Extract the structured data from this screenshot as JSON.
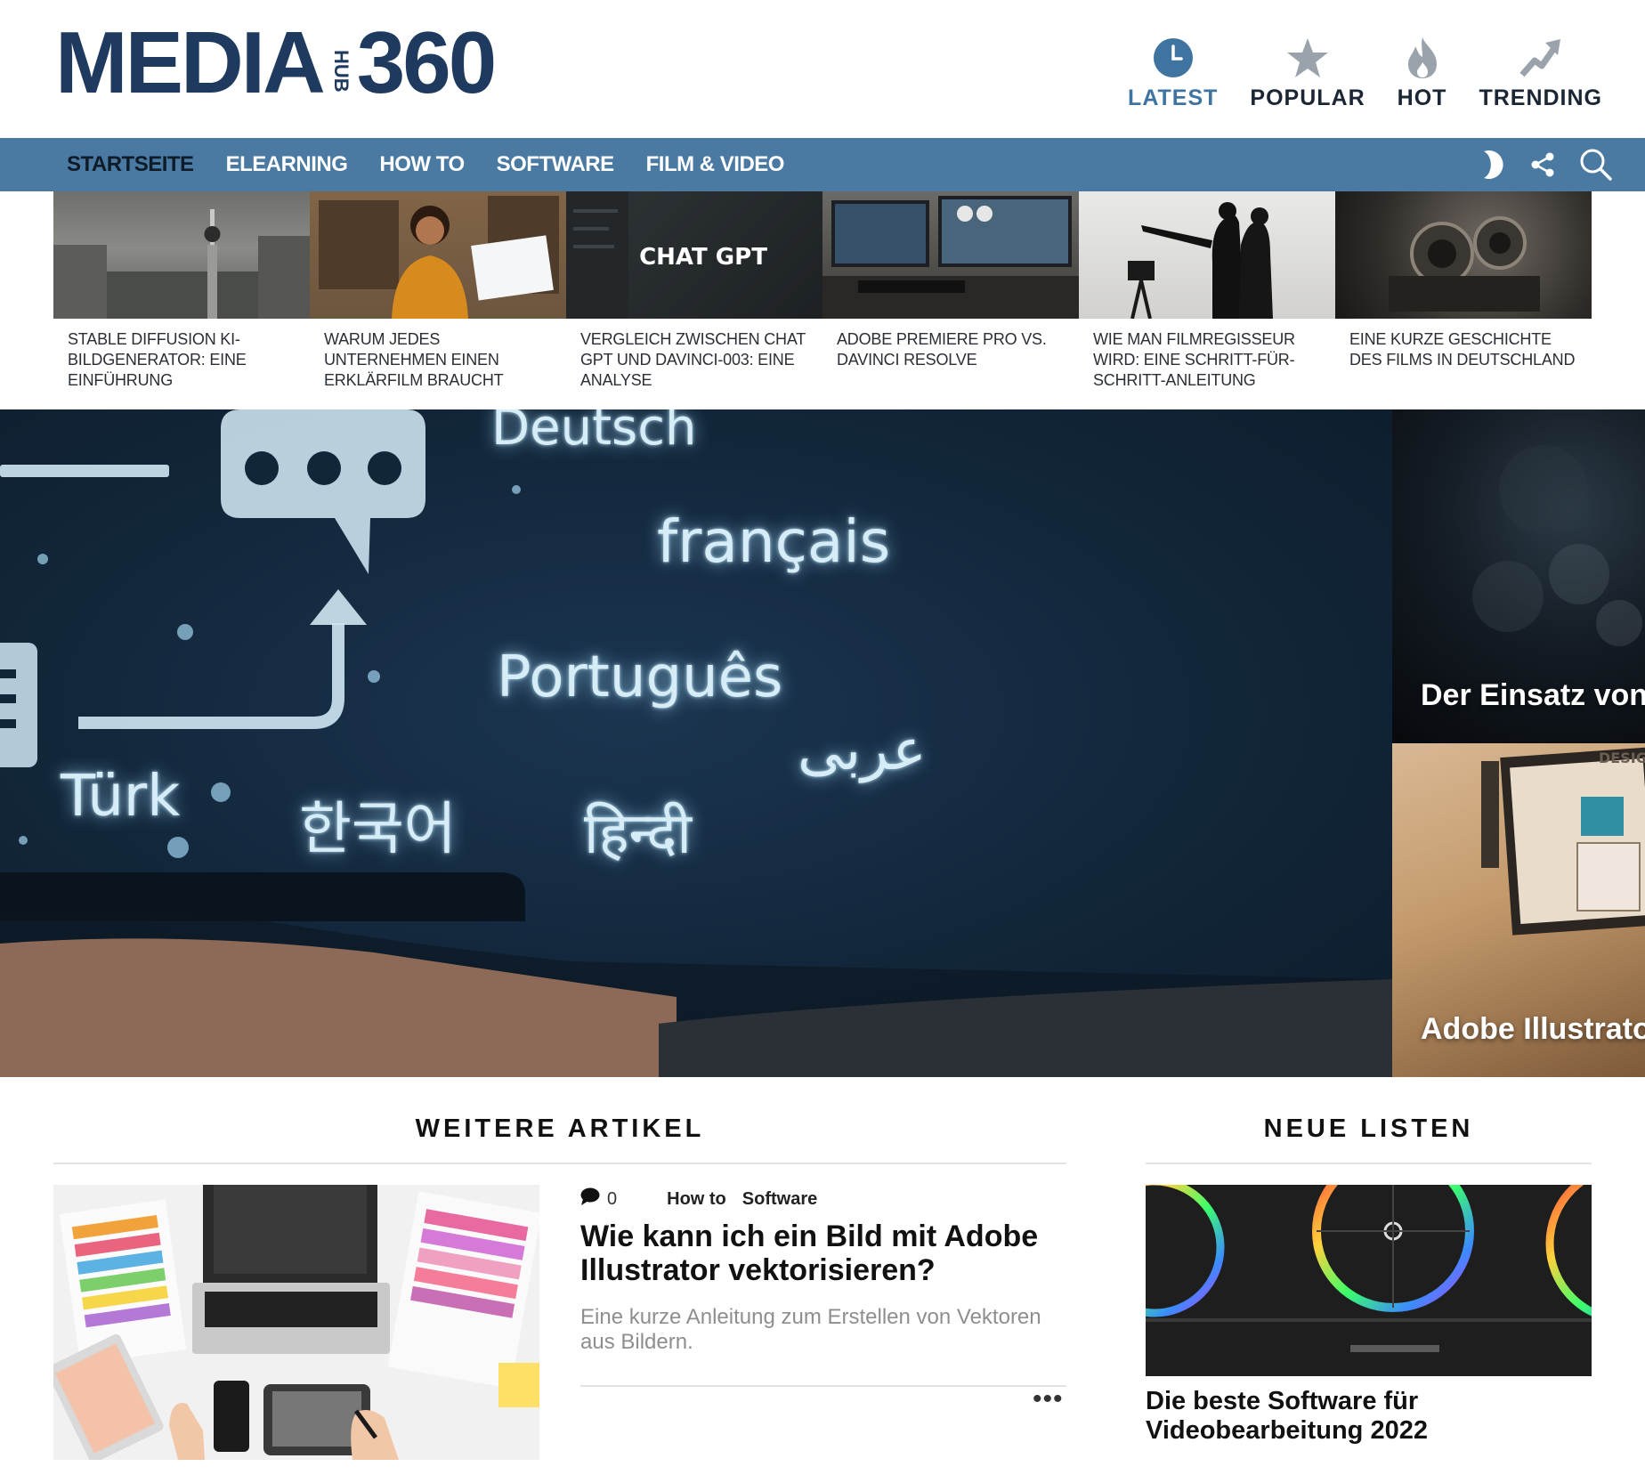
{
  "brand": {
    "logo_left": "MEDIA",
    "logo_hub": "HUB",
    "logo_right": "360"
  },
  "top_tabs": [
    {
      "label": "LATEST",
      "icon": "clock-icon",
      "active": true
    },
    {
      "label": "POPULAR",
      "icon": "star-icon"
    },
    {
      "label": "HOT",
      "icon": "flame-icon"
    },
    {
      "label": "TRENDING",
      "icon": "trending-arrow-icon"
    }
  ],
  "nav": {
    "items": [
      "STARTSEITE",
      "ELEARNING",
      "HOW TO",
      "SOFTWARE",
      "FILM & VIDEO"
    ],
    "active": "STARTSEITE",
    "icons": [
      "dark-mode-icon",
      "share-icon",
      "search-icon"
    ]
  },
  "carousel": [
    {
      "title": "STABLE DIFFUSION KI-BILDGENERATOR: EINE EINFÜHRUNG"
    },
    {
      "title": "WARUM JEDES UNTERNEHMEN EINEN ERKLÄRFILM BRAUCHT"
    },
    {
      "title": "VERGLEICH ZWISCHEN CHAT GPT UND DAVINCI-003: EINE ANALYSE",
      "image_text": "CHAT GPT"
    },
    {
      "title": "ADOBE PREMIERE PRO VS. DAVINCI RESOLVE"
    },
    {
      "title": "WIE MAN FILMREGISSEUR WIRD: EINE SCHRITT-FÜR-SCHRITT-ANLEITUNG"
    },
    {
      "title": "EINE KURZE GESCHICHTE DES FILMS IN DEUTSCHLAND"
    }
  ],
  "hero": {
    "languages": [
      "Deutsch",
      "français",
      "Português",
      "عربى",
      "Türk",
      "한국어",
      "हिन्दी"
    ]
  },
  "side_features": [
    {
      "title": "Der Einsatz von I"
    },
    {
      "title": "Adobe Illustrato",
      "image_text": "DESIGN"
    }
  ],
  "more_articles": {
    "heading": "WEITERE ARTIKEL",
    "article": {
      "comments": "0",
      "categories": [
        "How to",
        "Software"
      ],
      "title": "Wie kann ich ein Bild mit Adobe Illustrator vektorisieren?",
      "excerpt": "Eine kurze Anleitung zum Erstellen von Vektoren aus Bildern.",
      "more": "•••"
    }
  },
  "new_lists": {
    "heading": "NEUE LISTEN",
    "item": {
      "title": "Die beste Software für Videobearbeitung 2022"
    }
  },
  "colors": {
    "brand_navy": "#1f3a5f",
    "nav_blue": "#4a7aa2",
    "accent_blue": "#3f74a0"
  }
}
